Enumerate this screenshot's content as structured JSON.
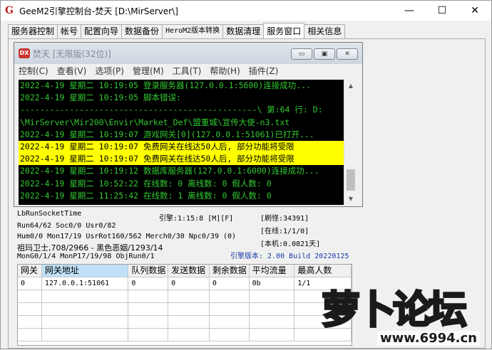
{
  "window": {
    "title": "GeeM2引擎控制台-焚天 [D:\\MirServer\\]",
    "minimize": "—",
    "maximize": "☐",
    "close": "✕"
  },
  "tabs": [
    {
      "label": "服务器控制"
    },
    {
      "label": "帐号"
    },
    {
      "label": "配置向导"
    },
    {
      "label": "数据备份"
    },
    {
      "label": "HeroM2版本转换"
    },
    {
      "label": "数据清理"
    },
    {
      "label": "服务窗口"
    },
    {
      "label": "相关信息"
    }
  ],
  "inner": {
    "icon": "DX",
    "title": "焚天 [无限版(32位)]",
    "menu": [
      "控制(C)",
      "查看(V)",
      "选项(P)",
      "管理(M)",
      "工具(T)",
      "帮助(H)",
      "插件(Z)"
    ],
    "buttons": {
      "min": "▭",
      "restore": "▣",
      "close": "✕"
    }
  },
  "console": {
    "lines": [
      {
        "text": "2022-4-19 星期二 10:19:05 登录服务器(127.0.0.1:5600)连接成功...",
        "highlight": false
      },
      {
        "text": "2022-4-19 星期二 10:19:05 脚本错误:",
        "highlight": false
      },
      {
        "text": "------------------------------------------------\\ 第:64 行: D:",
        "highlight": false
      },
      {
        "text": "\\MirServer\\Mir200\\Envir\\Market_Def\\盟重城\\宣传大使-n3.txt",
        "highlight": false
      },
      {
        "text": "2022-4-19 星期二 10:19:07 游戏网关[0](127.0.0.1:51061)已打开...",
        "highlight": false
      },
      {
        "text": "2022-4-19 星期二 10:19:07 免费网关在线达50人后, 部分功能将受限",
        "highlight": true
      },
      {
        "text": "2022-4-19 星期二 10:19:07 免费网关在线达50人后, 部分功能将受限",
        "highlight": true
      },
      {
        "text": "2022-4-19 星期二 10:19:12 数据库服务器(127.0.0.1:6000)连接成功...",
        "highlight": false
      },
      {
        "text": "2022-4-19 星期二 10:52:22 在线数: 0 离线数: 0 假人数: 0",
        "highlight": false
      },
      {
        "text": "2022-4-19 星期二 11:25:42 在线数: 1 离线数: 0 假人数: 0",
        "highlight": false
      }
    ]
  },
  "status": {
    "lb_run_socket": "LbRunSocketTime",
    "engine_time": "引擎:1:15:8 [M][F]",
    "refresh_monster": "[刷怪:34391]",
    "run_line": "Run64/62 Soc0/0 Usr0/82",
    "online": "[在线:1/1/0]",
    "hum_line": "Hum0/0 Mon17/19 UsrRot160/562 Merch0/30 Npc0/39 (0)",
    "machine": "[本机:0.0821天]",
    "guard_line": "祖玛卫士,708/2966 - 黑色恶姻/1293/14",
    "mon_line": "MonG0/1/4 MonP17/19/98 ObjRun0/1",
    "engine_version": "引擎版本: 2.00 Build 20220125"
  },
  "grid": {
    "headers": [
      "网关",
      "网关地址",
      "队列数据",
      "发送数据",
      "剩余数据",
      "平均流量",
      "最高人数"
    ],
    "rows": [
      [
        "0",
        "127.0.0.1:51061",
        "0",
        "0",
        "0",
        "0b",
        "1/1"
      ]
    ]
  },
  "watermark": {
    "big": "萝卜论坛",
    "url": "www.6994.cn"
  }
}
